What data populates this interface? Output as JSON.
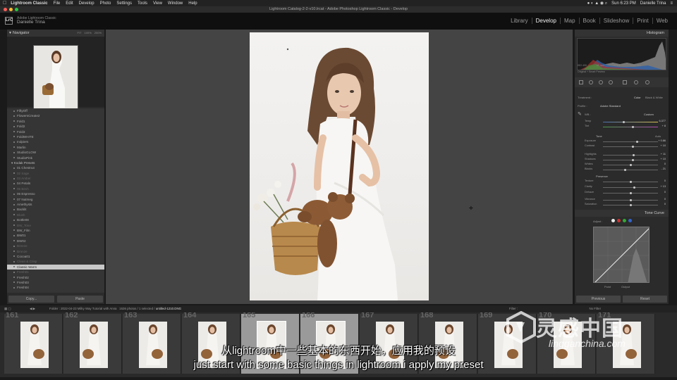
{
  "menubar": {
    "app": "Lightroom Classic",
    "items": [
      "File",
      "Edit",
      "Develop",
      "Photo",
      "Settings",
      "Tools",
      "View",
      "Window",
      "Help"
    ],
    "clock": "Sun 6:23 PM",
    "user": "Danielle Trina"
  },
  "window": {
    "title": "Lightroom Catalog-2-2-v10.lrcat - Adobe Photoshop Lightroom Classic - Develop"
  },
  "identity": {
    "product": "Adobe Lightroom Classic",
    "name": "Danielle Trina",
    "logo": "LrC"
  },
  "modules": [
    "Library",
    "Develop",
    "Map",
    "Book",
    "Slideshow",
    "Print",
    "Web"
  ],
  "active_module": "Develop",
  "navigator": {
    "title": "Navigator",
    "options": [
      "FIT",
      "100%",
      "200%"
    ]
  },
  "presets": [
    {
      "label": "FiftyOff",
      "type": "item"
    },
    {
      "label": "FlowersCreate2",
      "type": "item"
    },
    {
      "label": "Fold1",
      "type": "item"
    },
    {
      "label": "Fold2",
      "type": "item"
    },
    {
      "label": "Fold3",
      "type": "item"
    },
    {
      "label": "FoldWHITE",
      "type": "item"
    },
    {
      "label": "Indpiers",
      "type": "item"
    },
    {
      "label": "Marlin",
      "type": "item"
    },
    {
      "label": "StudioGLOW",
      "type": "item"
    },
    {
      "label": "StudioPink",
      "type": "item"
    },
    {
      "label": "Kodak Presets",
      "type": "folder"
    },
    {
      "label": "01 Chestnut",
      "type": "item"
    },
    {
      "label": "02 Sage",
      "type": "item",
      "dim": true
    },
    {
      "label": "03 Amber",
      "type": "item",
      "dim": true
    },
    {
      "label": "04 Petals",
      "type": "item"
    },
    {
      "label": "05 Birch",
      "type": "item",
      "dim": true
    },
    {
      "label": "06 Espresso",
      "type": "item"
    },
    {
      "label": "07 Nutmeg",
      "type": "item"
    },
    {
      "label": "Amethysts",
      "type": "item"
    },
    {
      "label": "Backlit",
      "type": "item"
    },
    {
      "label": "Blush",
      "type": "item",
      "dim": true
    },
    {
      "label": "Bottle08",
      "type": "item"
    },
    {
      "label": "BW_Tone",
      "type": "item",
      "dim": true
    },
    {
      "label": "BW_Film",
      "type": "item"
    },
    {
      "label": "BW01",
      "type": "item"
    },
    {
      "label": "BW02",
      "type": "item"
    },
    {
      "label": "Breeze",
      "type": "item",
      "dim": true
    },
    {
      "label": "Bronze",
      "type": "item",
      "dim": true
    },
    {
      "label": "Cocoa01",
      "type": "item"
    },
    {
      "label": "Clean & Crisp",
      "type": "item",
      "dim": true
    },
    {
      "label": "Classic Warm",
      "type": "item",
      "selected": true
    },
    {
      "label": "Fresh01",
      "type": "item",
      "dim": true
    },
    {
      "label": "Fresh02",
      "type": "item"
    },
    {
      "label": "Fresh03",
      "type": "item"
    },
    {
      "label": "Fresh04",
      "type": "item"
    }
  ],
  "left_buttons": {
    "copy": "Copy...",
    "paste": "Paste"
  },
  "right_panel": {
    "histogram_title": "Histogram",
    "readout": [
      "ISO 400",
      "85 mm",
      "f / 1.8",
      "1/200 sec"
    ],
    "original_preview": "Original + Smart Preview",
    "basic_tabs": [
      "Treatment :",
      "Color",
      "Black & White"
    ],
    "profile_label": "Profile :",
    "profile_value": "Adobe Standard",
    "wb_label": "WB :",
    "wb_value": "Custom",
    "temp": {
      "label": "Temp",
      "value": "6,377",
      "pos": 0.38
    },
    "tint": {
      "label": "Tint",
      "value": "+ 8",
      "pos": 0.55
    },
    "tone_label": "Tone",
    "tone_auto": "Auto",
    "tone": [
      {
        "label": "Exposure",
        "value": "+ 0.86",
        "pos": 0.62
      },
      {
        "label": "Contrast",
        "value": "+ 10",
        "pos": 0.55
      },
      {
        "label": "Highlights",
        "value": "+ 11",
        "pos": 0.56
      },
      {
        "label": "Shadows",
        "value": "+ 10",
        "pos": 0.55
      },
      {
        "label": "Whites",
        "value": "0",
        "pos": 0.5
      },
      {
        "label": "Blacks",
        "value": "- 21",
        "pos": 0.4
      }
    ],
    "presence_label": "Presence",
    "presence": [
      {
        "label": "Texture",
        "value": "0",
        "pos": 0.5
      },
      {
        "label": "Clarity",
        "value": "+ 13",
        "pos": 0.57
      },
      {
        "label": "Dehaze",
        "value": "0",
        "pos": 0.5
      },
      {
        "label": "Vibrance",
        "value": "0",
        "pos": 0.5
      },
      {
        "label": "Saturation",
        "value": "0",
        "pos": 0.5
      }
    ],
    "tone_curve_title": "Tone Curve",
    "adjust_label": "Adjust :",
    "curve_labels": [
      "Point",
      "Output"
    ],
    "prev_button": "Previous",
    "reset_button": "Reset"
  },
  "filmbar": {
    "folder": "Folder : 2022-04-23 Milky Way Tutorial with Anna",
    "count": "1636 photos / 1 selected /",
    "file": "untitled-1210.DNG",
    "filter_label": "Filter :",
    "filter_value": "No Filter"
  },
  "filmstrip": {
    "numbers": [
      "161",
      "162",
      "163",
      "164",
      "165",
      "166",
      "167",
      "168",
      "169",
      "170",
      "171"
    ],
    "selected_index": 5
  },
  "subtitles": {
    "chinese": "从lightroom中一些基本的东西开始，应用我的预设",
    "english": "just start with some basic things in lightroom i apply my preset"
  },
  "watermark": {
    "chinese": "灵感中国",
    "url": "lingganchina.com"
  },
  "colors": {
    "panel_bg": "#2b2b2b",
    "center_bg": "#444444",
    "active_module": "#eeeeee"
  }
}
